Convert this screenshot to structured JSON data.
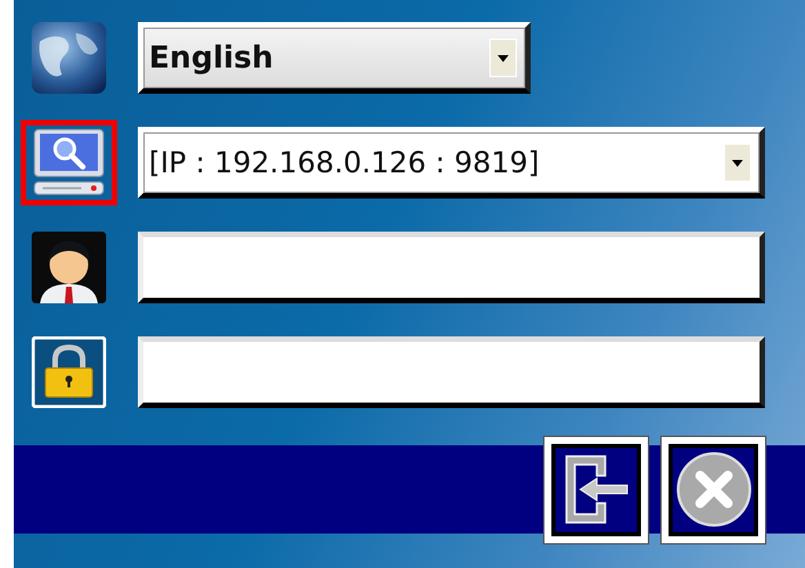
{
  "rows": [
    {
      "kind": "dropdown",
      "value": "English",
      "selected": false
    },
    {
      "kind": "dropdown",
      "value": "[IP : 192.168.0.126 : 9819]",
      "selected": true
    },
    {
      "kind": "text",
      "selected": false
    },
    {
      "kind": "password",
      "selected": false
    }
  ]
}
